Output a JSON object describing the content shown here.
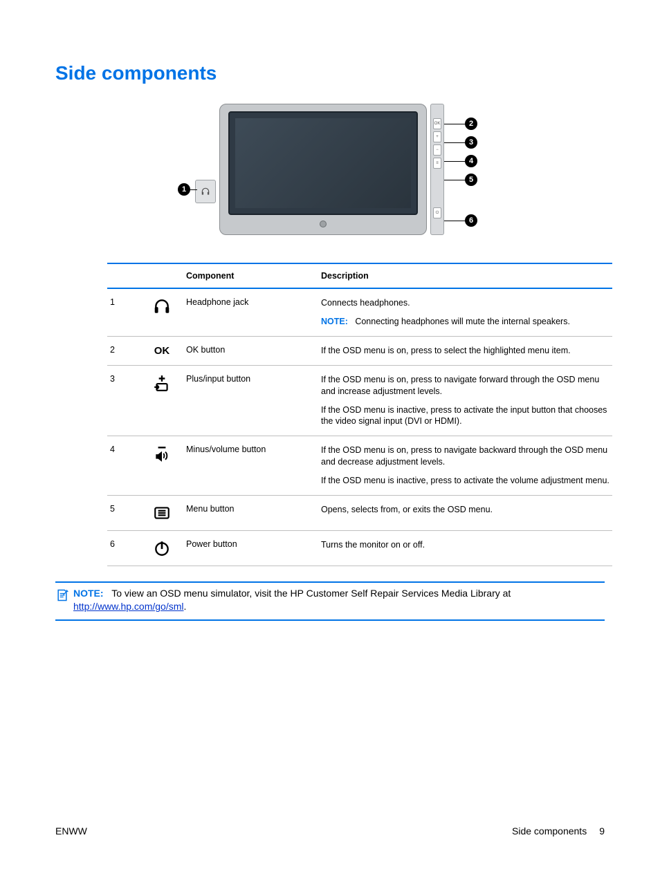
{
  "heading": "Side components",
  "table": {
    "headers": {
      "component": "Component",
      "description": "Description"
    },
    "rows": [
      {
        "num": "1",
        "icon": "headphone-icon",
        "name": "Headphone jack",
        "desc": [
          {
            "text": "Connects headphones."
          },
          {
            "note_label": "NOTE:",
            "text": "Connecting headphones will mute the internal speakers."
          }
        ]
      },
      {
        "num": "2",
        "icon": "ok-icon",
        "icon_text": "OK",
        "name": "OK button",
        "desc": [
          {
            "text": "If the OSD menu is on, press to select the highlighted menu item."
          }
        ]
      },
      {
        "num": "3",
        "icon": "plus-input-icon",
        "name": "Plus/input button",
        "desc": [
          {
            "text": "If the OSD menu is on, press to navigate forward through the OSD menu and increase adjustment levels."
          },
          {
            "text": "If the OSD menu is inactive, press to activate the input button that chooses the video signal input (DVI or HDMI)."
          }
        ]
      },
      {
        "num": "4",
        "icon": "minus-volume-icon",
        "name": "Minus/volume button",
        "desc": [
          {
            "text": "If the OSD menu is on, press to navigate backward through the OSD menu and decrease adjustment levels."
          },
          {
            "text": "If the OSD menu is inactive, press to activate the volume adjustment menu."
          }
        ]
      },
      {
        "num": "5",
        "icon": "menu-icon",
        "name": "Menu button",
        "desc": [
          {
            "text": "Opens, selects from, or exits the OSD menu."
          }
        ]
      },
      {
        "num": "6",
        "icon": "power-icon",
        "name": "Power button",
        "desc": [
          {
            "text": "Turns the monitor on or off."
          }
        ]
      }
    ]
  },
  "bottom_note": {
    "label": "NOTE:",
    "text_before_link": "To view an OSD menu simulator, visit the HP Customer Self Repair Services Media Library at ",
    "link_text": "http://www.hp.com/go/sml",
    "text_after_link": "."
  },
  "footer": {
    "left": "ENWW",
    "right_label": "Side components",
    "page": "9"
  },
  "diagram_callouts": [
    "1",
    "2",
    "3",
    "4",
    "5",
    "6"
  ]
}
